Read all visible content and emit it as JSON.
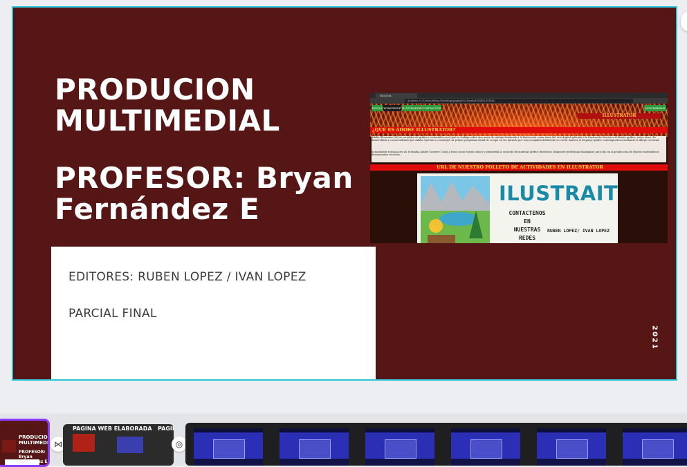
{
  "slide": {
    "title_lines": [
      "PRODUCION",
      "MULTIMEDIAL"
    ],
    "professor_lines": [
      "PROFESOR: Bryan",
      "Fernández E"
    ],
    "editors": "EDITORES: RUBEN LOPEZ  / IVAN LOPEZ",
    "section": "PARCIAL FINAL",
    "year": "2021",
    "colors": {
      "background": "#561615",
      "selection_border": "#2ec4d6"
    }
  },
  "screenshot": {
    "tab_label": "EDITOR",
    "url": "Archivo  C:/Users/ideas/Desktop/pagina%20web/INDEX.HTML",
    "nav": [
      "INICIO",
      "WHATSHOP",
      "ILUSTRADOR",
      "CONTACTOS",
      "SUSCRIBIRSE"
    ],
    "header_title": "ILLUSTRATOR",
    "question": "¿QUE ES ADOBE ILLUSTRATOR?",
    "paragraph1": "Adobe Illustrator (AI) es un editor de gráficos vectoriales en el que se trabaja sobre una mesa de trabajo destinada a la ilustración como rama del arte digital aplicado a la ilustración técnica o al diseño gráfico, entre otros. Es desarrollado y comercializado por Adobe Systems y constituye su primer programa oficial de su tipo en ser lanzado por esta compañía definiendo en cierta manera el lenguaje gráfico contemporáneo mediante el dibujo vectorial.",
    "paragraph2": "Actualmente forma parte de la familia Adobe Creative Cloud y tiene como función única y primordial la creación de material gráfico-ilustrativo altamente profesional basándose para ello en la producción de objetos matemáticos denominados vectores.",
    "link_bar": "URL DE NUESTRO FOLLETO DE ACTIVIDADES EN ILLUSTRATOR",
    "flyer": {
      "title": "ILUSTRAITOR",
      "subtitle_lines": [
        "CONTACTENOS",
        "EN",
        "NUESTRAS",
        "REDES"
      ],
      "authors": "RUBEN LOPEZ/ IVAN LOPEZ"
    }
  },
  "thumbnails": {
    "page1": {
      "title": "PRODUCION MULTIMEDIAL",
      "subtitle": "PROFESOR: Bryan Fernández E"
    },
    "page2": {
      "title": "PAGINA WEB ELABORADA",
      "title2": "PAGIN"
    },
    "transition_icons": [
      "bowtie-icon",
      "target-icon"
    ]
  }
}
